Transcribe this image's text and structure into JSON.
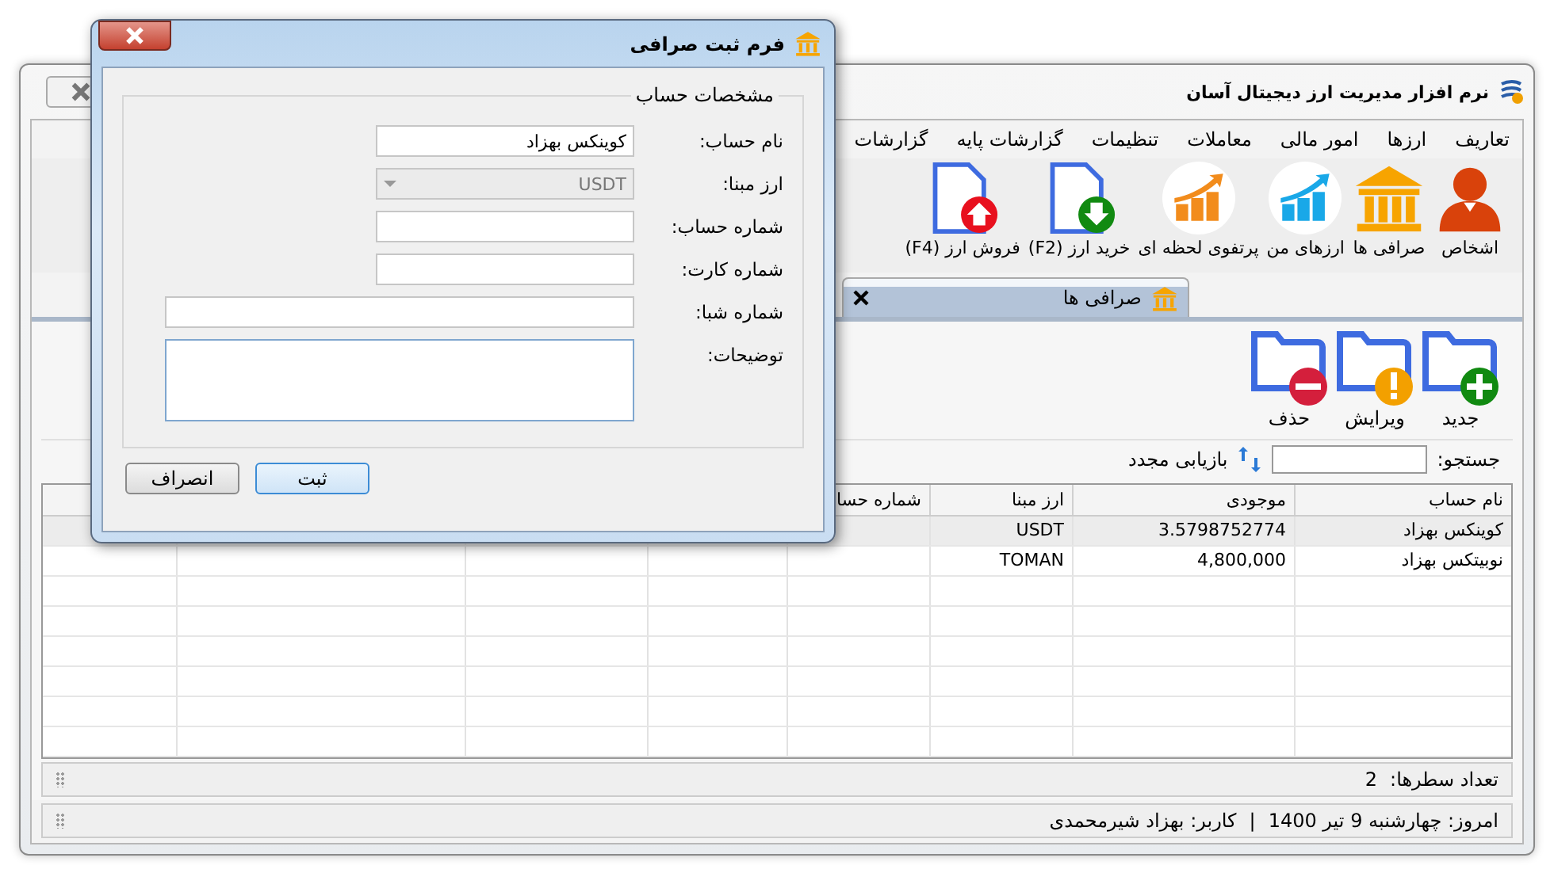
{
  "main_window": {
    "title": "نرم افزار مدیریت ارز دیجیتال آسان"
  },
  "menu": [
    "تعاریف",
    "ارزها",
    "امور مالی",
    "معاملات",
    "تنظیمات",
    "گزارشات پایه",
    "گزارشات"
  ],
  "toolbar": [
    "اشخاص",
    "صرافی ها",
    "ارزهای من",
    "پرتفوی لحظه ای",
    "خرید ارز (F2)",
    "فروش ارز (F4)"
  ],
  "tabs": [
    {
      "label": "صرافی ها",
      "selected": true
    }
  ],
  "actions": [
    "جدید",
    "ویرایش",
    "حذف"
  ],
  "search": {
    "label": "جستجو:",
    "refresh": "بازیابی مجدد"
  },
  "table": {
    "columns": [
      "نام حساب",
      "موجودی",
      "ارز مبنا",
      "شماره حسا"
    ],
    "rows": [
      {
        "selected": true,
        "cells": [
          "کوینکس بهزاد",
          "3.5798752774",
          "USDT",
          null
        ]
      },
      {
        "selected": false,
        "cells": [
          "نوبیتکس بهزاد",
          "4,800,000",
          "TOMAN",
          null
        ]
      }
    ]
  },
  "row_count": {
    "label": "تعداد سطرها:",
    "value": "2"
  },
  "status_bar": [
    "امروز: چهارشنبه 9 تیر 1400",
    "|",
    "کاربر: بهزاد شیرمحمدی"
  ],
  "dialog": {
    "title": "فرم ثبت صرافی",
    "group": "مشخصات حساب",
    "fields": [
      {
        "kind": "text",
        "label": "نام حساب:",
        "value": "کوینکس بهزاد",
        "wide": false
      },
      {
        "kind": "combo",
        "label": "ارز مبنا:",
        "value": "USDT",
        "disabled": true
      },
      {
        "kind": "text",
        "label": "شماره حساب:",
        "wide": false
      },
      {
        "kind": "text",
        "label": "شماره کارت:",
        "wide": false
      },
      {
        "kind": "text",
        "label": "شماره شبا:",
        "wide": true
      },
      {
        "kind": "textarea",
        "label": "توضیحات:"
      }
    ],
    "buttons": [
      {
        "label": "ثبت",
        "default": true
      },
      {
        "label": "انصراف",
        "default": false
      }
    ]
  }
}
